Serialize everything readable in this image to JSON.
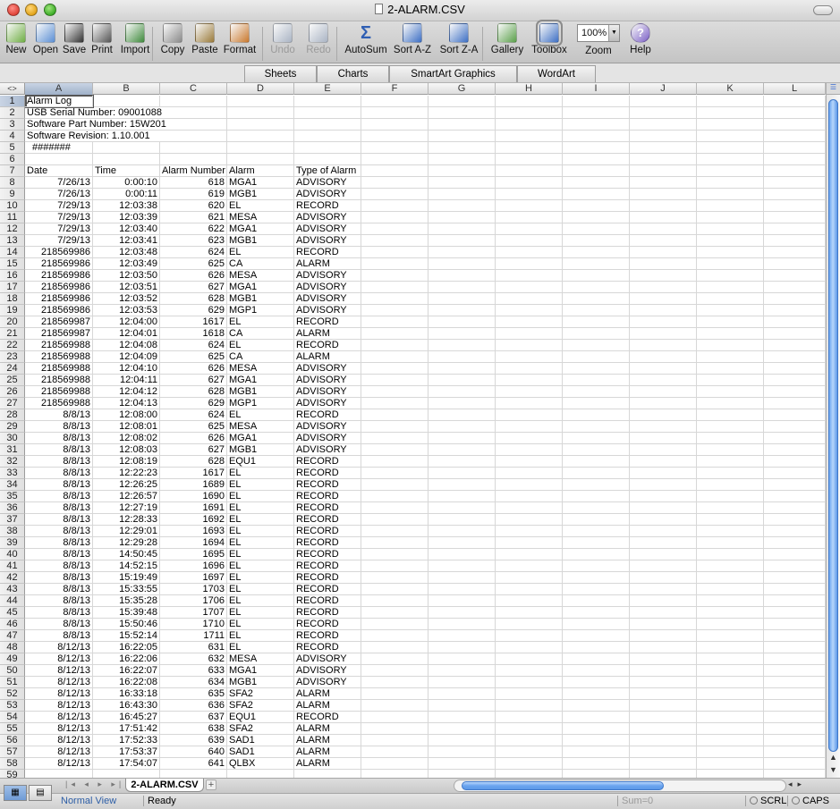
{
  "window": {
    "title": "2-ALARM.CSV"
  },
  "toolbar": {
    "buttons": [
      {
        "label": "New",
        "icon": "new-document-icon"
      },
      {
        "label": "Open",
        "icon": "open-folder-icon"
      },
      {
        "label": "Save",
        "icon": "save-disk-icon"
      },
      {
        "label": "Print",
        "icon": "printer-icon"
      },
      {
        "label": "Import",
        "icon": "import-icon"
      },
      {
        "label": "Copy",
        "icon": "copy-icon"
      },
      {
        "label": "Paste",
        "icon": "paste-clipboard-icon"
      },
      {
        "label": "Format",
        "icon": "format-brush-icon"
      },
      {
        "label": "Undo",
        "icon": "undo-arrow-icon",
        "disabled": true
      },
      {
        "label": "Redo",
        "icon": "redo-arrow-icon",
        "disabled": true
      },
      {
        "label": "AutoSum",
        "icon": "sigma-icon"
      },
      {
        "label": "Sort A-Z",
        "icon": "sort-ascending-icon"
      },
      {
        "label": "Sort Z-A",
        "icon": "sort-descending-icon"
      },
      {
        "label": "Gallery",
        "icon": "gallery-icon"
      },
      {
        "label": "Toolbox",
        "icon": "toolbox-icon",
        "active": true
      },
      {
        "label": "Zoom",
        "icon": "zoom-select-icon"
      },
      {
        "label": "Help",
        "icon": "help-question-icon"
      }
    ],
    "zoom_value": "100%"
  },
  "ribbon": {
    "tabs": [
      "Sheets",
      "Charts",
      "SmartArt Graphics",
      "WordArt"
    ]
  },
  "grid": {
    "columns": [
      "A",
      "B",
      "C",
      "D",
      "E",
      "F",
      "G",
      "H",
      "I",
      "J",
      "K",
      "L"
    ],
    "selected_cell": "A1",
    "rows": [
      {
        "n": "1",
        "a": "Alarm Log"
      },
      {
        "n": "2",
        "a": "USB Serial Number: 09001088"
      },
      {
        "n": "3",
        "a": "Software Part Number: 15W201"
      },
      {
        "n": "4",
        "a": "Software Revision: 1.10.001"
      },
      {
        "n": "5",
        "a": "#######"
      },
      {
        "n": "6"
      },
      {
        "n": "7",
        "a": "Date",
        "b": "Time",
        "c": "Alarm Number",
        "d": "Alarm",
        "e": "Type of Alarm"
      },
      {
        "n": "8",
        "a": "7/26/13",
        "b": "0:00:10",
        "c": "618",
        "d": "MGA1",
        "e": "ADVISORY"
      },
      {
        "n": "9",
        "a": "7/26/13",
        "b": "0:00:11",
        "c": "619",
        "d": "MGB1",
        "e": "ADVISORY"
      },
      {
        "n": "10",
        "a": "7/29/13",
        "b": "12:03:38",
        "c": "620",
        "d": "EL",
        "e": "RECORD"
      },
      {
        "n": "11",
        "a": "7/29/13",
        "b": "12:03:39",
        "c": "621",
        "d": "MESA",
        "e": "ADVISORY"
      },
      {
        "n": "12",
        "a": "7/29/13",
        "b": "12:03:40",
        "c": "622",
        "d": "MGA1",
        "e": "ADVISORY"
      },
      {
        "n": "13",
        "a": "7/29/13",
        "b": "12:03:41",
        "c": "623",
        "d": "MGB1",
        "e": "ADVISORY"
      },
      {
        "n": "14",
        "a": "218569986",
        "b": "12:03:48",
        "c": "624",
        "d": "EL",
        "e": "RECORD"
      },
      {
        "n": "15",
        "a": "218569986",
        "b": "12:03:49",
        "c": "625",
        "d": "CA",
        "e": "ALARM"
      },
      {
        "n": "16",
        "a": "218569986",
        "b": "12:03:50",
        "c": "626",
        "d": "MESA",
        "e": "ADVISORY"
      },
      {
        "n": "17",
        "a": "218569986",
        "b": "12:03:51",
        "c": "627",
        "d": "MGA1",
        "e": "ADVISORY"
      },
      {
        "n": "18",
        "a": "218569986",
        "b": "12:03:52",
        "c": "628",
        "d": "MGB1",
        "e": "ADVISORY"
      },
      {
        "n": "19",
        "a": "218569986",
        "b": "12:03:53",
        "c": "629",
        "d": "MGP1",
        "e": "ADVISORY"
      },
      {
        "n": "20",
        "a": "218569987",
        "b": "12:04:00",
        "c": "1617",
        "d": "EL",
        "e": "RECORD"
      },
      {
        "n": "21",
        "a": "218569987",
        "b": "12:04:01",
        "c": "1618",
        "d": "CA",
        "e": "ALARM"
      },
      {
        "n": "22",
        "a": "218569988",
        "b": "12:04:08",
        "c": "624",
        "d": "EL",
        "e": "RECORD"
      },
      {
        "n": "23",
        "a": "218569988",
        "b": "12:04:09",
        "c": "625",
        "d": "CA",
        "e": "ALARM"
      },
      {
        "n": "24",
        "a": "218569988",
        "b": "12:04:10",
        "c": "626",
        "d": "MESA",
        "e": "ADVISORY"
      },
      {
        "n": "25",
        "a": "218569988",
        "b": "12:04:11",
        "c": "627",
        "d": "MGA1",
        "e": "ADVISORY"
      },
      {
        "n": "26",
        "a": "218569988",
        "b": "12:04:12",
        "c": "628",
        "d": "MGB1",
        "e": "ADVISORY"
      },
      {
        "n": "27",
        "a": "218569988",
        "b": "12:04:13",
        "c": "629",
        "d": "MGP1",
        "e": "ADVISORY"
      },
      {
        "n": "28",
        "a": "8/8/13",
        "b": "12:08:00",
        "c": "624",
        "d": "EL",
        "e": "RECORD"
      },
      {
        "n": "29",
        "a": "8/8/13",
        "b": "12:08:01",
        "c": "625",
        "d": "MESA",
        "e": "ADVISORY"
      },
      {
        "n": "30",
        "a": "8/8/13",
        "b": "12:08:02",
        "c": "626",
        "d": "MGA1",
        "e": "ADVISORY"
      },
      {
        "n": "31",
        "a": "8/8/13",
        "b": "12:08:03",
        "c": "627",
        "d": "MGB1",
        "e": "ADVISORY"
      },
      {
        "n": "32",
        "a": "8/8/13",
        "b": "12:08:19",
        "c": "628",
        "d": "EQU1",
        "e": "RECORD"
      },
      {
        "n": "33",
        "a": "8/8/13",
        "b": "12:22:23",
        "c": "1617",
        "d": "EL",
        "e": "RECORD"
      },
      {
        "n": "34",
        "a": "8/8/13",
        "b": "12:26:25",
        "c": "1689",
        "d": "EL",
        "e": "RECORD"
      },
      {
        "n": "35",
        "a": "8/8/13",
        "b": "12:26:57",
        "c": "1690",
        "d": "EL",
        "e": "RECORD"
      },
      {
        "n": "36",
        "a": "8/8/13",
        "b": "12:27:19",
        "c": "1691",
        "d": "EL",
        "e": "RECORD"
      },
      {
        "n": "37",
        "a": "8/8/13",
        "b": "12:28:33",
        "c": "1692",
        "d": "EL",
        "e": "RECORD"
      },
      {
        "n": "38",
        "a": "8/8/13",
        "b": "12:29:01",
        "c": "1693",
        "d": "EL",
        "e": "RECORD"
      },
      {
        "n": "39",
        "a": "8/8/13",
        "b": "12:29:28",
        "c": "1694",
        "d": "EL",
        "e": "RECORD"
      },
      {
        "n": "40",
        "a": "8/8/13",
        "b": "14:50:45",
        "c": "1695",
        "d": "EL",
        "e": "RECORD"
      },
      {
        "n": "41",
        "a": "8/8/13",
        "b": "14:52:15",
        "c": "1696",
        "d": "EL",
        "e": "RECORD"
      },
      {
        "n": "42",
        "a": "8/8/13",
        "b": "15:19:49",
        "c": "1697",
        "d": "EL",
        "e": "RECORD"
      },
      {
        "n": "43",
        "a": "8/8/13",
        "b": "15:33:55",
        "c": "1703",
        "d": "EL",
        "e": "RECORD"
      },
      {
        "n": "44",
        "a": "8/8/13",
        "b": "15:35:28",
        "c": "1706",
        "d": "EL",
        "e": "RECORD"
      },
      {
        "n": "45",
        "a": "8/8/13",
        "b": "15:39:48",
        "c": "1707",
        "d": "EL",
        "e": "RECORD"
      },
      {
        "n": "46",
        "a": "8/8/13",
        "b": "15:50:46",
        "c": "1710",
        "d": "EL",
        "e": "RECORD"
      },
      {
        "n": "47",
        "a": "8/8/13",
        "b": "15:52:14",
        "c": "1711",
        "d": "EL",
        "e": "RECORD"
      },
      {
        "n": "48",
        "a": "8/12/13",
        "b": "16:22:05",
        "c": "631",
        "d": "EL",
        "e": "RECORD"
      },
      {
        "n": "49",
        "a": "8/12/13",
        "b": "16:22:06",
        "c": "632",
        "d": "MESA",
        "e": "ADVISORY"
      },
      {
        "n": "50",
        "a": "8/12/13",
        "b": "16:22:07",
        "c": "633",
        "d": "MGA1",
        "e": "ADVISORY"
      },
      {
        "n": "51",
        "a": "8/12/13",
        "b": "16:22:08",
        "c": "634",
        "d": "MGB1",
        "e": "ADVISORY"
      },
      {
        "n": "52",
        "a": "8/12/13",
        "b": "16:33:18",
        "c": "635",
        "d": "SFA2",
        "e": "ALARM"
      },
      {
        "n": "53",
        "a": "8/12/13",
        "b": "16:43:30",
        "c": "636",
        "d": "SFA2",
        "e": "ALARM"
      },
      {
        "n": "54",
        "a": "8/12/13",
        "b": "16:45:27",
        "c": "637",
        "d": "EQU1",
        "e": "RECORD"
      },
      {
        "n": "55",
        "a": "8/12/13",
        "b": "17:51:42",
        "c": "638",
        "d": "SFA2",
        "e": "ALARM"
      },
      {
        "n": "56",
        "a": "8/12/13",
        "b": "17:52:33",
        "c": "639",
        "d": "SAD1",
        "e": "ALARM"
      },
      {
        "n": "57",
        "a": "8/12/13",
        "b": "17:53:37",
        "c": "640",
        "d": "SAD1",
        "e": "ALARM"
      },
      {
        "n": "58",
        "a": "8/12/13",
        "b": "17:54:07",
        "c": "641",
        "d": "QLBX",
        "e": "ALARM"
      },
      {
        "n": "59"
      }
    ]
  },
  "sheet_tabs": {
    "active": "2-ALARM.CSV",
    "add_label": "+"
  },
  "statusbar": {
    "view": "Normal View",
    "state": "Ready",
    "sum": "Sum=0",
    "scrl": "SCRL",
    "caps": "CAPS"
  }
}
